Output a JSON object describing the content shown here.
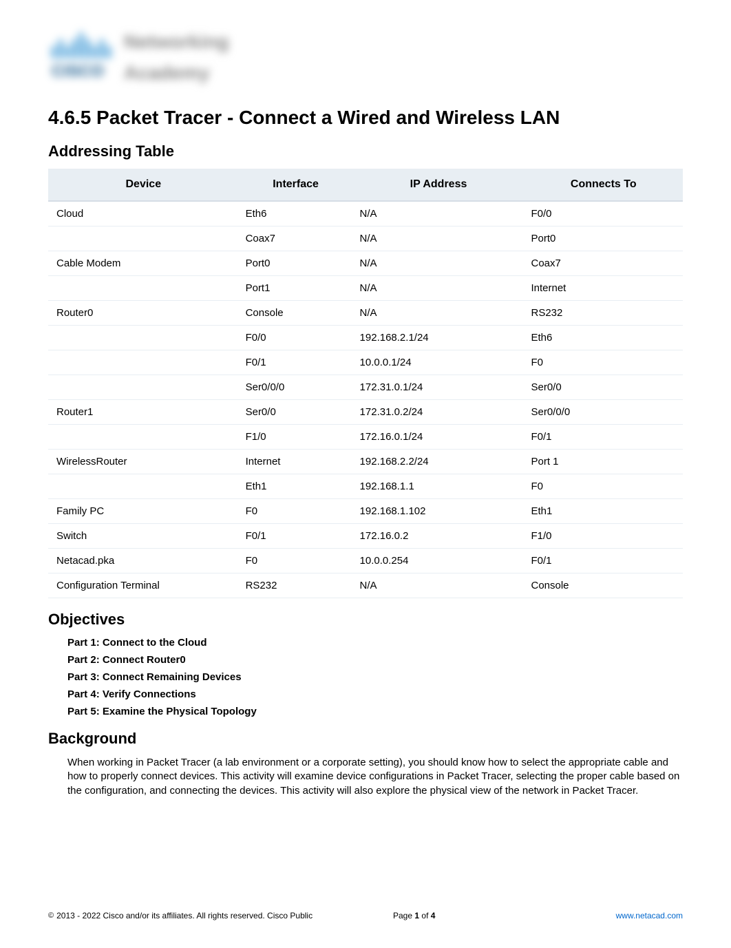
{
  "title": "4.6.5 Packet Tracer - Connect a Wired and Wireless LAN",
  "addressing_heading": "Addressing Table",
  "table": {
    "headers": [
      "Device",
      "Interface",
      "IP Address",
      "Connects To"
    ],
    "rows": [
      {
        "device": "Cloud",
        "interface": "Eth6",
        "ip": "N/A",
        "connects": "F0/0"
      },
      {
        "device": "",
        "interface": "Coax7",
        "ip": "N/A",
        "connects": "Port0"
      },
      {
        "device": "Cable Modem",
        "interface": "Port0",
        "ip": "N/A",
        "connects": "Coax7"
      },
      {
        "device": "",
        "interface": "Port1",
        "ip": "N/A",
        "connects": "Internet"
      },
      {
        "device": "Router0",
        "interface": "Console",
        "ip": "N/A",
        "connects": "RS232"
      },
      {
        "device": "",
        "interface": "F0/0",
        "ip": "192.168.2.1/24",
        "connects": "Eth6"
      },
      {
        "device": "",
        "interface": "F0/1",
        "ip": "10.0.0.1/24",
        "connects": "F0"
      },
      {
        "device": "",
        "interface": "Ser0/0/0",
        "ip": "172.31.0.1/24",
        "connects": "Ser0/0"
      },
      {
        "device": "Router1",
        "interface": "Ser0/0",
        "ip": "172.31.0.2/24",
        "connects": "Ser0/0/0"
      },
      {
        "device": "",
        "interface": "F1/0",
        "ip": "172.16.0.1/24",
        "connects": "F0/1"
      },
      {
        "device": "WirelessRouter",
        "interface": "Internet",
        "ip": "192.168.2.2/24",
        "connects": "Port 1"
      },
      {
        "device": "",
        "interface": "Eth1",
        "ip": "192.168.1.1",
        "connects": "F0"
      },
      {
        "device": "Family PC",
        "interface": "F0",
        "ip": "192.168.1.102",
        "connects": "Eth1"
      },
      {
        "device": "Switch",
        "interface": "F0/1",
        "ip": "172.16.0.2",
        "connects": "F1/0"
      },
      {
        "device": "Netacad.pka",
        "interface": "F0",
        "ip": "10.0.0.254",
        "connects": "F0/1"
      },
      {
        "device": "Configuration Terminal",
        "interface": "RS232",
        "ip": "N/A",
        "connects": "Console"
      }
    ]
  },
  "objectives_heading": "Objectives",
  "objectives": [
    "Part 1: Connect to the Cloud",
    "Part 2: Connect Router0",
    "Part 3: Connect Remaining Devices",
    "Part 4: Verify Connections",
    "Part 5: Examine the Physical Topology"
  ],
  "background_heading": "Background",
  "background_text": "When working in Packet Tracer (a lab environment or a corporate setting), you should know how to select the appropriate cable and how to properly connect devices. This activity will examine device configurations in Packet Tracer, selecting the proper cable based on the configuration, and connecting the devices. This activity will also explore the physical view of the network in Packet Tracer.",
  "footer": {
    "copyright": "2013 - 2022 Cisco and/or its affiliates. All rights reserved. Cisco Public",
    "page_label": "Page",
    "page_current": "1",
    "page_of": "of",
    "page_total": "4",
    "link": "www.netacad.com"
  }
}
